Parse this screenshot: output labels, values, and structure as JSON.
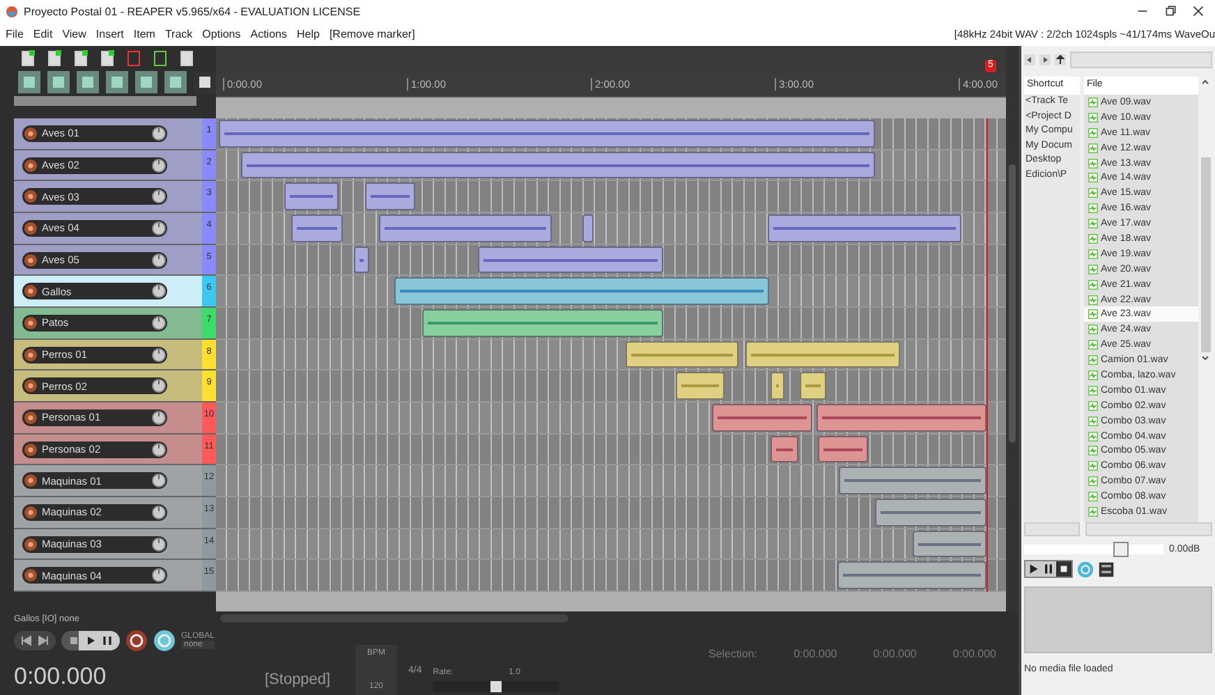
{
  "window": {
    "title": "Proyecto Postal 01 - REAPER v5.965/x64 - EVALUATION LICENSE"
  },
  "menu": [
    "File",
    "Edit",
    "View",
    "Insert",
    "Item",
    "Track",
    "Options",
    "Actions",
    "Help",
    "[Remove marker]"
  ],
  "audio_info": "[48kHz 24bit WAV : 2/2ch 1024spls ~41/174ms WaveOu",
  "ruler": {
    "labels": [
      "0:00.00",
      "1:00.00",
      "2:00.00",
      "3:00.00",
      "4:00.00"
    ],
    "marker": "5"
  },
  "tracks": [
    {
      "name": "Aves 01",
      "number": "1",
      "color": "#8a8aff",
      "selected": false
    },
    {
      "name": "Aves 02",
      "number": "2",
      "color": "#8a8aff",
      "selected": false
    },
    {
      "name": "Aves 03",
      "number": "3",
      "color": "#8a8aff",
      "selected": false
    },
    {
      "name": "Aves 04",
      "number": "4",
      "color": "#8a8aff",
      "selected": false
    },
    {
      "name": "Aves 05",
      "number": "5",
      "color": "#8a8aff",
      "selected": false
    },
    {
      "name": "Gallos",
      "number": "6",
      "color": "#3ec8f0",
      "selected": true
    },
    {
      "name": "Patos",
      "number": "7",
      "color": "#3ddc6a",
      "selected": false
    },
    {
      "name": "Perros 01",
      "number": "8",
      "color": "#ffe030",
      "selected": false
    },
    {
      "name": "Perros 02",
      "number": "9",
      "color": "#ffe030",
      "selected": false
    },
    {
      "name": "Personas 01",
      "number": "10",
      "color": "#ff5a5a",
      "selected": false
    },
    {
      "name": "Personas 02",
      "number": "11",
      "color": "#ff5a5a",
      "selected": false
    },
    {
      "name": "Maquinas 01",
      "number": "12",
      "color": "#8f9aa0",
      "selected": false
    },
    {
      "name": "Maquinas 02",
      "number": "13",
      "color": "#8f9aa0",
      "selected": false
    },
    {
      "name": "Maquinas 03",
      "number": "14",
      "color": "#8f9aa0",
      "selected": false
    },
    {
      "name": "Maquinas 04",
      "number": "15",
      "color": "#8f9aa0",
      "selected": false
    }
  ],
  "status_line": "Gallos [IO] none",
  "transport": {
    "time": "0:00.000",
    "state": "[Stopped]",
    "automation": "GLOBAL",
    "automation_mode": "none",
    "bpm_label": "BPM",
    "bpm": "120",
    "signature": "4/4",
    "rate_label": "Rate:",
    "rate": "1.0",
    "rate_slider": {
      "level": 0.5
    },
    "selection_label": "Selection:",
    "selection": [
      "0:00.000",
      "0:00.000",
      "0:00.000"
    ]
  },
  "media_explorer": {
    "shortcut_header": "Shortcut",
    "file_header": "File",
    "shortcuts": [
      "<Track Te",
      "<Project D",
      "My Compu",
      "My Docum",
      "Desktop",
      "Edicion\\P"
    ],
    "files": [
      {
        "name": "Ave 09.wav",
        "selected": false
      },
      {
        "name": "Ave 10.wav",
        "selected": false
      },
      {
        "name": "Ave 11.wav",
        "selected": false
      },
      {
        "name": "Ave 12.wav",
        "selected": false
      },
      {
        "name": "Ave 13.wav",
        "selected": false
      },
      {
        "name": "Ave 14.wav",
        "selected": false
      },
      {
        "name": "Ave 15.wav",
        "selected": false
      },
      {
        "name": "Ave 16.wav",
        "selected": false
      },
      {
        "name": "Ave 17.wav",
        "selected": false
      },
      {
        "name": "Ave 18.wav",
        "selected": false
      },
      {
        "name": "Ave 19.wav",
        "selected": false
      },
      {
        "name": "Ave 20.wav",
        "selected": false
      },
      {
        "name": "Ave 21.wav",
        "selected": false
      },
      {
        "name": "Ave 22.wav",
        "selected": false
      },
      {
        "name": "Ave 23.wav",
        "selected": true
      },
      {
        "name": "Ave 24.wav",
        "selected": false
      },
      {
        "name": "Ave 25.wav",
        "selected": false
      },
      {
        "name": "Camion 01.wav",
        "selected": false
      },
      {
        "name": "Comba, lazo.wav",
        "selected": false
      },
      {
        "name": "Combo 01.wav",
        "selected": false
      },
      {
        "name": "Combo 02.wav",
        "selected": false
      },
      {
        "name": "Combo 03.wav",
        "selected": false
      },
      {
        "name": "Combo 04.wav",
        "selected": false
      },
      {
        "name": "Combo 05.wav",
        "selected": false
      },
      {
        "name": "Combo 06.wav",
        "selected": false
      },
      {
        "name": "Combo 07.wav",
        "selected": false
      },
      {
        "name": "Combo 08.wav",
        "selected": false
      },
      {
        "name": "Escoba 01.wav",
        "selected": false
      }
    ],
    "volume": {
      "level": 0.7,
      "reading": "0.00dB"
    },
    "status": "No media file loaded"
  }
}
